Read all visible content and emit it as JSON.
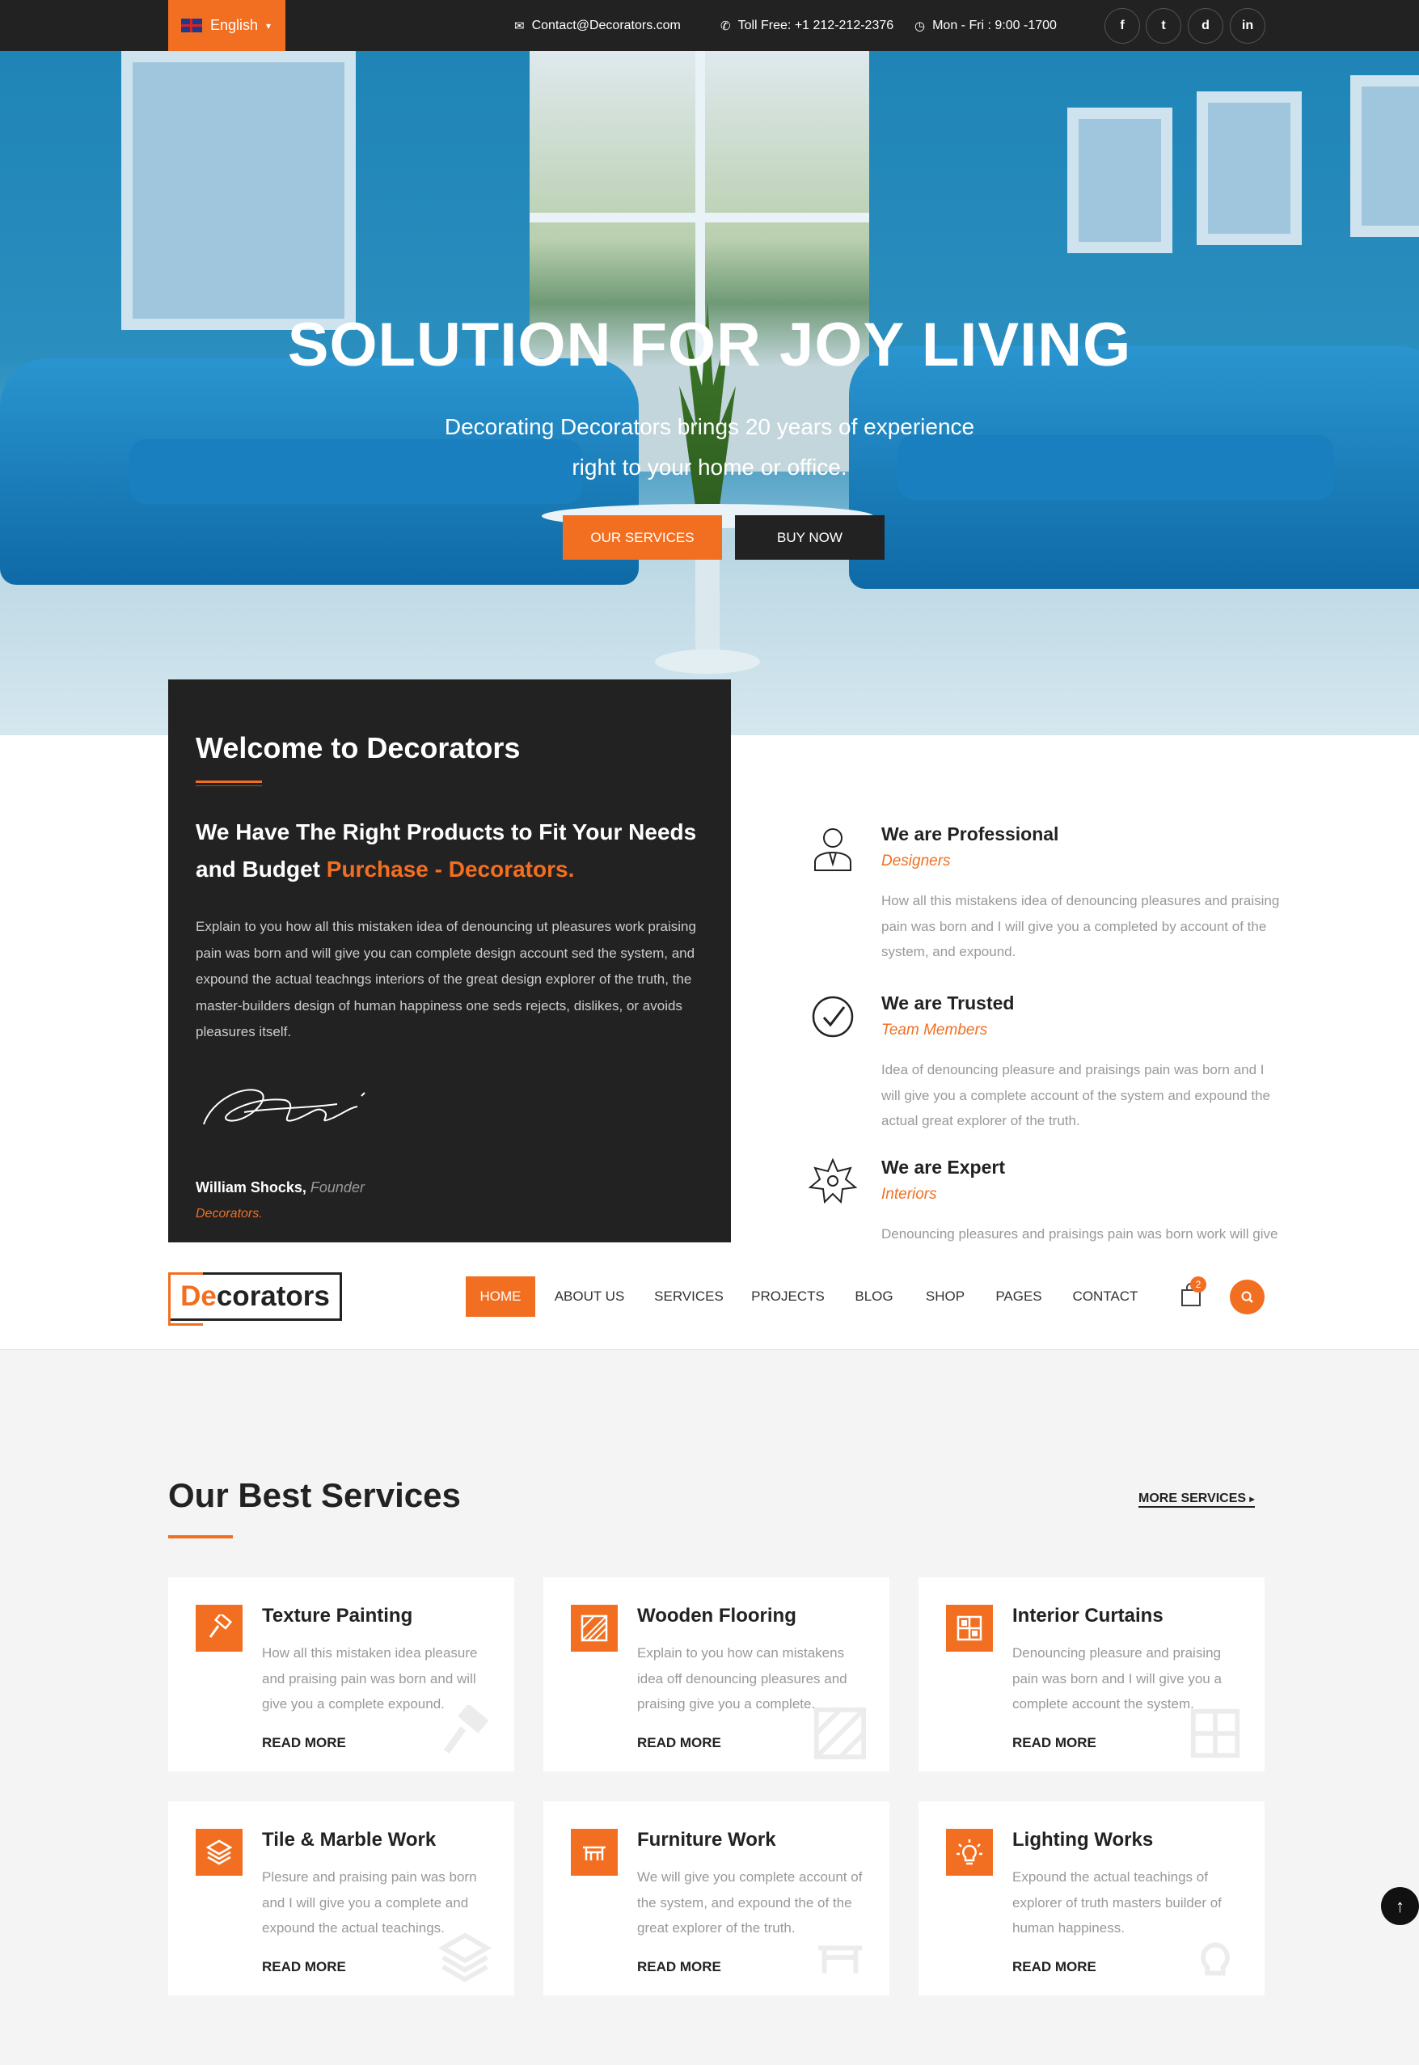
{
  "colors": {
    "accent": "#f26f21",
    "dark": "#222222",
    "muted": "#999999"
  },
  "topbar": {
    "language": "English",
    "email": "Contact@Decorators.com",
    "phone": "Toll Free: +1 212-212-2376",
    "hours": "Mon - Fri : 9:00 -1700",
    "social": [
      "f",
      "t",
      "d",
      "in"
    ],
    "social_icons": [
      "facebook-icon",
      "twitter-icon",
      "dribbble-icon",
      "linkedin-icon"
    ]
  },
  "hero": {
    "title": "SOLUTION FOR JOY LIVING",
    "subtitle_line1": "Decorating Decorators brings 20 years of experience",
    "subtitle_line2": "right to your home or office.",
    "primary_button": "OUR SERVICES",
    "secondary_button": "BUY NOW"
  },
  "welcome": {
    "title": "Welcome to Decorators",
    "headline_main": "We Have The Right Products to Fit Your Needs and Budget",
    "headline_accent": "Purchase - Decorators.",
    "body": "Explain to you how all this mistaken idea of denouncing ut pleasures work praising pain was born and will give you can complete design account sed the system, and expound the actual teachngs interiors of the great design explorer of the truth, the master-builders design of human happiness one seds rejects, dislikes, or avoids pleasures itself.",
    "founder_name": "William Shocks,",
    "founder_role": "Founder",
    "company": "Decorators."
  },
  "features": [
    {
      "title": "We are Professional",
      "subtitle": "Designers",
      "desc": "How all this mistakens idea of denouncing pleasures and praising pain was born and I will give you a completed by account of the system, and expound.",
      "icon": "professional-person-icon"
    },
    {
      "title": "We are Trusted",
      "subtitle": "Team Members",
      "desc": "Idea of denouncing pleasure and praisings pain was born and I will give you a complete account of the system and expound the actual great explorer of the truth.",
      "icon": "check-circle-icon"
    },
    {
      "title": "We are Expert",
      "subtitle": "Interiors",
      "desc": "Denouncing pleasures and praisings pain was born work will give",
      "icon": "star-badge-icon"
    }
  ],
  "nav": {
    "logo_accent": "De",
    "logo_rest": "corators",
    "items": [
      "HOME",
      "ABOUT US",
      "SERVICES",
      "PROJECTS",
      "BLOG",
      "SHOP",
      "PAGES",
      "CONTACT"
    ],
    "active": "HOME",
    "cart_count": "2"
  },
  "services": {
    "title": "Our Best Services",
    "more_label": "MORE SERVICES",
    "read_more": "READ MORE",
    "items": [
      {
        "title": "Texture Painting",
        "desc": "How all this mistaken idea pleasure and praising pain was born and will give you a complete expound.",
        "icon": "paint-roller-icon"
      },
      {
        "title": "Wooden Flooring",
        "desc": "Explain to you how can mistakens idea off denouncing pleasures and praising give you a complete.",
        "icon": "flooring-icon"
      },
      {
        "title": "Interior Curtains",
        "desc": "Denouncing pleasure and praising pain was born and I will give you a complete account the system.",
        "icon": "window-curtain-icon"
      },
      {
        "title": "Tile & Marble Work",
        "desc": "Plesure and praising pain was born and I will give you a complete and expound the actual teachings.",
        "icon": "tile-layers-icon"
      },
      {
        "title": "Furniture Work",
        "desc": "We will give you complete account of the system, and expound the of the great explorer of the truth.",
        "icon": "furniture-table-icon"
      },
      {
        "title": "Lighting Works",
        "desc": "Expound the actual teachings of explorer of truth masters builder of human happiness.",
        "icon": "light-bulb-icon"
      }
    ]
  }
}
